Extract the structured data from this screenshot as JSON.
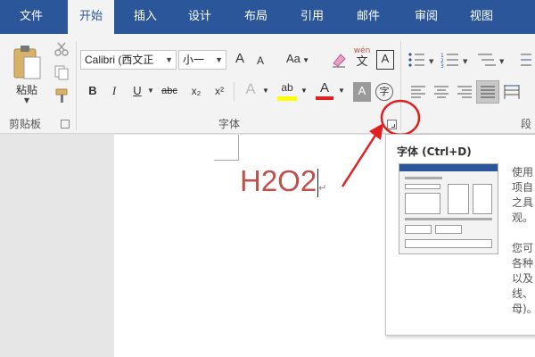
{
  "tabs": [
    "文件",
    "开始",
    "插入",
    "设计",
    "布局",
    "引用",
    "邮件",
    "审阅",
    "视图"
  ],
  "clipboard": {
    "paste_label": "粘贴",
    "group_label": "剪贴板"
  },
  "font": {
    "font_name": "Calibri (西文正",
    "font_size": "小一",
    "grow": "A",
    "shrink": "A",
    "change_case": "Aa",
    "phonetic_top": "wén",
    "phonetic_bottom": "文",
    "char_border": "A",
    "bold": "B",
    "italic": "I",
    "underline": "U",
    "strike": "abc",
    "subscript": "x₂",
    "superscript": "x²",
    "effects": "A",
    "highlight": "ab",
    "font_color": "A",
    "shading": "A",
    "enclose": "字",
    "group_label": "字体"
  },
  "paragraph": {
    "group_label": "段"
  },
  "document": {
    "text": "H2O2",
    "mark": "↵"
  },
  "tooltip": {
    "title": "字体 (Ctrl+D)",
    "lines": [
      "使用",
      "项自",
      "之具",
      "观。",
      "",
      "您可",
      "各种",
      "以及",
      "线、",
      "母)。"
    ]
  },
  "colors": {
    "accent": "#2b579a",
    "text_red": "#c0504d",
    "annotation": "#e02020",
    "highlight": "#ffff00"
  }
}
